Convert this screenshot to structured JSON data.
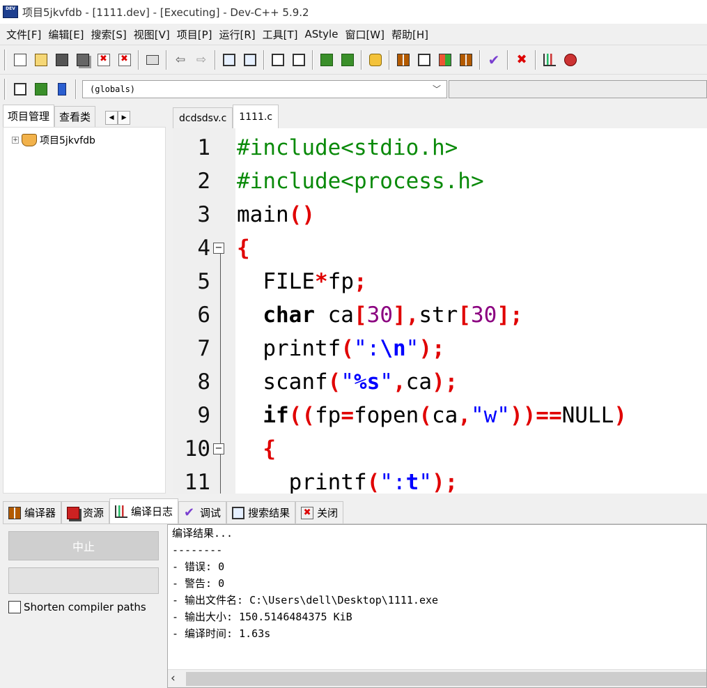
{
  "window": {
    "title": "项目5jkvfdb - [1111.dev] - [Executing] - Dev-C++ 5.9.2",
    "icon_text": "DEV"
  },
  "menu": [
    "文件[F]",
    "编辑[E]",
    "搜索[S]",
    "视图[V]",
    "项目[P]",
    "运行[R]",
    "工具[T]",
    "AStyle",
    "窗口[W]",
    "帮助[H]"
  ],
  "toolbar2": {
    "combo_value": "(globals)"
  },
  "left_panel": {
    "tabs": [
      "项目管理",
      "查看类"
    ],
    "active_tab": "项目管理",
    "tree_root": "项目5jkvfdb",
    "expand_glyph": "+"
  },
  "editor": {
    "tabs": [
      "dcdsdsv.c",
      "1111.c"
    ],
    "active_tab": "1111.c",
    "line_numbers": [
      "1",
      "2",
      "3",
      "4",
      "5",
      "6",
      "7",
      "8",
      "9",
      "10",
      "11"
    ],
    "code_lines": [
      "#include<stdio.h>",
      "#include<process.h>",
      "main()",
      "{",
      "  FILE*fp;",
      "  char ca[30],str[30];",
      "  printf(\":\\n\");",
      "  scanf(\"%s\",ca);",
      "  if((fp=fopen(ca,\"w\"))==NULL)",
      "  {",
      "    printf(\":t\");"
    ]
  },
  "bottom": {
    "tabs": [
      {
        "label": "编译器",
        "icon": "compiler-icon"
      },
      {
        "label": "资源",
        "icon": "resources-icon"
      },
      {
        "label": "编译日志",
        "icon": "compile-log-icon"
      },
      {
        "label": "调试",
        "icon": "debug-icon"
      },
      {
        "label": "搜索结果",
        "icon": "search-results-icon"
      },
      {
        "label": "关闭",
        "icon": "close-icon"
      }
    ],
    "active_tab": "编译日志",
    "stop_button": "中止",
    "shorten_paths_label": "Shorten compiler paths",
    "shorten_paths_checked": false,
    "log_lines": [
      "编译结果...",
      "--------",
      "- 错误: 0",
      "- 警告: 0",
      "- 输出文件名: C:\\Users\\dell\\Desktop\\1111.exe",
      "- 输出大小: 150.5146484375 KiB",
      "- 编译时间: 1.63s"
    ]
  },
  "colors": {
    "keyword_red": "#e00000",
    "include_green": "#0a8a0a",
    "number_purple": "#8b0080",
    "string_blue": "#0000ff"
  }
}
